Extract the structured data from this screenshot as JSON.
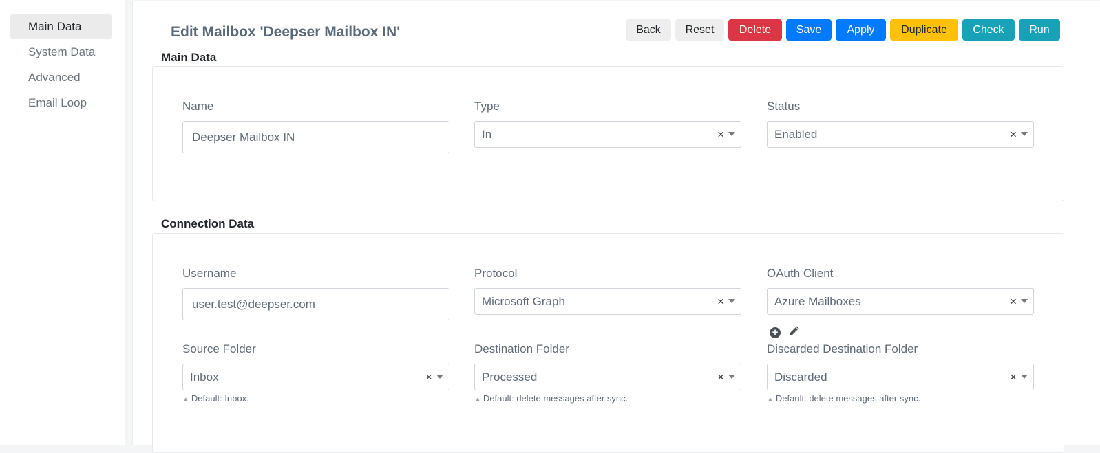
{
  "sidebar": {
    "items": [
      {
        "label": "Main Data"
      },
      {
        "label": "System Data"
      },
      {
        "label": "Advanced"
      },
      {
        "label": "Email Loop"
      }
    ]
  },
  "header": {
    "title": "Edit Mailbox 'Deepser Mailbox IN'"
  },
  "toolbar": {
    "back": "Back",
    "reset": "Reset",
    "delete": "Delete",
    "save": "Save",
    "apply": "Apply",
    "duplicate": "Duplicate",
    "check": "Check",
    "run": "Run"
  },
  "colors": {
    "danger": "#dc3545",
    "primary": "#007bff",
    "warning": "#ffc107",
    "info": "#17a2b8",
    "light": "#eeeeee"
  },
  "main_data": {
    "title": "Main Data",
    "name": {
      "label": "Name",
      "value": "Deepser Mailbox IN"
    },
    "type": {
      "label": "Type",
      "value": "In"
    },
    "status": {
      "label": "Status",
      "value": "Enabled"
    }
  },
  "connection_data": {
    "title": "Connection Data",
    "username": {
      "label": "Username",
      "value": "user.test@deepser.com"
    },
    "protocol": {
      "label": "Protocol",
      "value": "Microsoft Graph"
    },
    "oauth_client": {
      "label": "OAuth Client",
      "value": "Azure Mailboxes"
    },
    "source_folder": {
      "label": "Source Folder",
      "value": "Inbox",
      "help": "Default: Inbox."
    },
    "destination_folder": {
      "label": "Destination Folder",
      "value": "Processed",
      "help": "Default: delete messages after sync."
    },
    "discarded_folder": {
      "label": "Discarded Destination Folder",
      "value": "Discarded",
      "help": "Default: delete messages after sync."
    }
  },
  "icons": {
    "clear": "×",
    "add": "plus-circle-icon",
    "edit": "pencil-icon",
    "help": "triangle-up-icon"
  }
}
